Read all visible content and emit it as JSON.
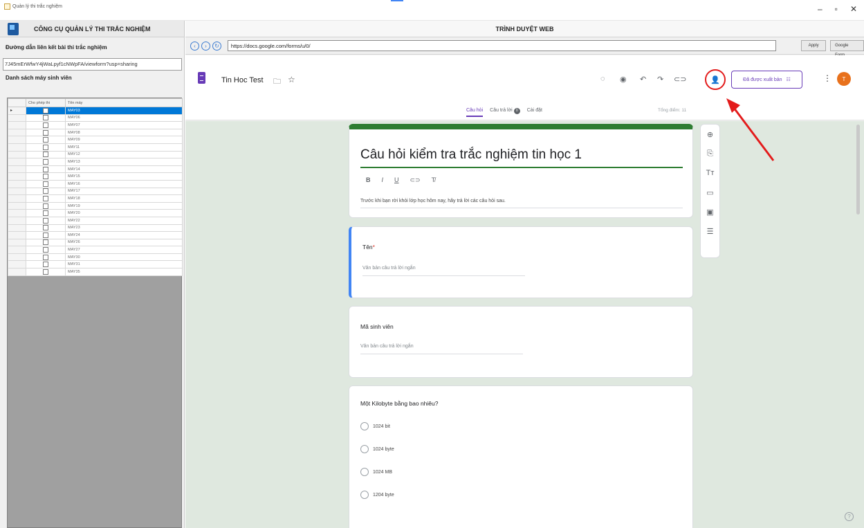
{
  "window": {
    "title": "Quản lý thi trắc nghiệm",
    "controls": [
      "–",
      "▫",
      "✕"
    ]
  },
  "left": {
    "app_title": "CÔNG CỤ QUẢN LÝ THI TRẮC NGHIỆM",
    "link_label": "Đường dẫn liên kết bài thi trắc nghiệm",
    "link_value": "7J45mErWfwY4jWaLpyf1cNWpFA/viewform?usp=sharing",
    "machines_label": "Danh sách máy sinh viên",
    "grid_headers": [
      "",
      "Cho phép thi",
      "Tên máy"
    ],
    "machines": [
      "MAY03",
      "MAY06",
      "MAY07",
      "MAY08",
      "MAY09",
      "MAY11",
      "MAY12",
      "MAY13",
      "MAY14",
      "MAY15",
      "MAY16",
      "MAY17",
      "MAY18",
      "MAY19",
      "MAY20",
      "MAY22",
      "MAY23",
      "MAY24",
      "MAY26",
      "MAY27",
      "MAY30",
      "MAY31",
      "MAY35"
    ]
  },
  "browser": {
    "title": "TRÌNH DUYỆT WEB",
    "url": "https://docs.google.com/forms/u/0/",
    "buttons": [
      "Apply",
      "Google Form"
    ]
  },
  "forms": {
    "form_name": "Tin Hoc Test",
    "publish_label": "Đã được xuất bản",
    "avatar_initial": "T",
    "tabs": [
      "Câu hỏi",
      "Câu trả lời",
      "Cài đặt"
    ],
    "response_count": "0",
    "total_points": "Tổng điểm: 11",
    "title": "Câu hỏi kiểm tra trắc nghiệm tin học 1",
    "format_buttons": [
      "B",
      "I",
      "U",
      "⊂⊃",
      "T̸"
    ],
    "description": "Trước khi bạn rời khỏi lớp học hôm nay, hãy trả lời các câu hỏi sau.",
    "questions": [
      {
        "label": "Tên",
        "required": "*",
        "placeholder": "Văn bản câu trả lời ngắn"
      },
      {
        "label": "Mã sinh viên",
        "placeholder": "Văn bản câu trả lời ngắn"
      },
      {
        "label": "Một Kilobyte bằng bao nhiêu?",
        "options": [
          "1024 bit",
          "1024 byte",
          "1024 MB",
          "1204 byte"
        ]
      }
    ],
    "side_tools": [
      "⊕",
      "⎘",
      "Tт",
      "▭",
      "▣",
      "☰"
    ]
  },
  "colors": {
    "accent": "#673ab7",
    "theme_green": "#2e7d32",
    "highlight": "#e31b1b",
    "selection": "#0078d7"
  }
}
